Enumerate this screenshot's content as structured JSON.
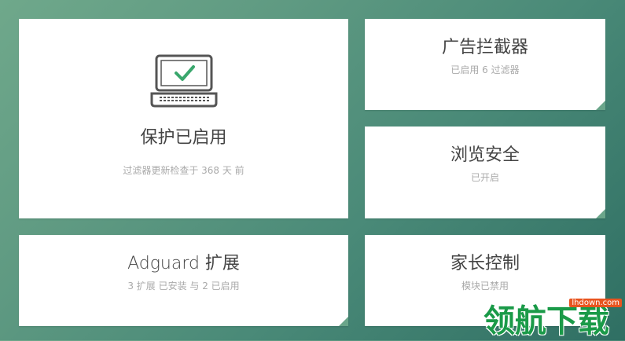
{
  "protection": {
    "title": "保护已启用",
    "subtitle": "过滤器更新检查于 368 天 前",
    "icon": "laptop-check-icon",
    "check_color": "#3aa76d"
  },
  "adblock": {
    "title": "广告拦截器",
    "subtitle": "已启用 6 过滤器"
  },
  "browsing": {
    "title": "浏览安全",
    "subtitle": "已开启"
  },
  "extensions": {
    "title": "Adguard 扩展",
    "subtitle": "3 扩展 已安装 与 2 已启用"
  },
  "parental": {
    "title": "家长控制",
    "subtitle": "模块已禁用"
  },
  "watermark": {
    "text": "领航下载",
    "url": "lhdown.com"
  },
  "colors": {
    "accent": "#6aa58a",
    "background_start": "#6fa88b",
    "background_end": "#2f6f63"
  }
}
